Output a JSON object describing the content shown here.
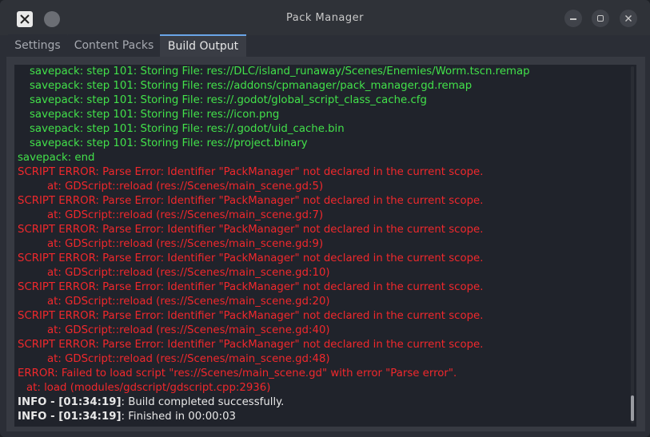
{
  "window": {
    "title": "Pack Manager"
  },
  "tabs": [
    {
      "label": "Settings",
      "active": false
    },
    {
      "label": "Content Packs",
      "active": false
    },
    {
      "label": "Build Output",
      "active": true
    }
  ],
  "console": {
    "lines": [
      {
        "text": "savepack: step 101: Storing File: res://DLC/island_runaway/Scenes/Enemies/Worm.tscn.remap",
        "color": "green",
        "indent": 1
      },
      {
        "text": "savepack: step 101: Storing File: res://addons/cpmanager/pack_manager.gd.remap",
        "color": "green",
        "indent": 1
      },
      {
        "text": "savepack: step 101: Storing File: res://.godot/global_script_class_cache.cfg",
        "color": "green",
        "indent": 1
      },
      {
        "text": "savepack: step 101: Storing File: res://icon.png",
        "color": "green",
        "indent": 1
      },
      {
        "text": "savepack: step 101: Storing File: res://.godot/uid_cache.bin",
        "color": "green",
        "indent": 1
      },
      {
        "text": "savepack: step 101: Storing File: res://project.binary",
        "color": "green",
        "indent": 1
      },
      {
        "text": "savepack: end",
        "color": "green",
        "indent": 0
      },
      {
        "text": "SCRIPT ERROR: Parse Error: Identifier \"PackManager\" not declared in the current scope.",
        "color": "red",
        "indent": 0
      },
      {
        "text": "at: GDScript::reload (res://Scenes/main_scene.gd:5)",
        "color": "red",
        "indent": 2
      },
      {
        "text": "SCRIPT ERROR: Parse Error: Identifier \"PackManager\" not declared in the current scope.",
        "color": "red",
        "indent": 0
      },
      {
        "text": "at: GDScript::reload (res://Scenes/main_scene.gd:7)",
        "color": "red",
        "indent": 2
      },
      {
        "text": "SCRIPT ERROR: Parse Error: Identifier \"PackManager\" not declared in the current scope.",
        "color": "red",
        "indent": 0
      },
      {
        "text": "at: GDScript::reload (res://Scenes/main_scene.gd:9)",
        "color": "red",
        "indent": 2
      },
      {
        "text": "SCRIPT ERROR: Parse Error: Identifier \"PackManager\" not declared in the current scope.",
        "color": "red",
        "indent": 0
      },
      {
        "text": "at: GDScript::reload (res://Scenes/main_scene.gd:10)",
        "color": "red",
        "indent": 2
      },
      {
        "text": "SCRIPT ERROR: Parse Error: Identifier \"PackManager\" not declared in the current scope.",
        "color": "red",
        "indent": 0
      },
      {
        "text": "at: GDScript::reload (res://Scenes/main_scene.gd:20)",
        "color": "red",
        "indent": 2
      },
      {
        "text": "SCRIPT ERROR: Parse Error: Identifier \"PackManager\" not declared in the current scope.",
        "color": "red",
        "indent": 0
      },
      {
        "text": "at: GDScript::reload (res://Scenes/main_scene.gd:40)",
        "color": "red",
        "indent": 2
      },
      {
        "text": "SCRIPT ERROR: Parse Error: Identifier \"PackManager\" not declared in the current scope.",
        "color": "red",
        "indent": 0
      },
      {
        "text": "at: GDScript::reload (res://Scenes/main_scene.gd:48)",
        "color": "red",
        "indent": 2
      },
      {
        "text": "ERROR: Failed to load script \"res://Scenes/main_scene.gd\" with error \"Parse error\".",
        "color": "red",
        "indent": 0
      },
      {
        "text": "at: load (modules/gdscript/gdscript.cpp:2936)",
        "color": "red",
        "indent": 3
      },
      {
        "prefix": "INFO - [01:34:19]",
        "text": ": Build completed successfully.",
        "color": "white",
        "indent": 0
      },
      {
        "prefix": "INFO - [01:34:19]",
        "text": ": Finished in 00:00:03",
        "color": "white",
        "indent": 0
      }
    ]
  },
  "colors": {
    "info_green": "#42e14a",
    "error_red": "#f0282c",
    "info_white": "#e8e8e8",
    "tab_accent": "#6aa5e8"
  },
  "icons": {
    "app": "x-logo-icon",
    "pin": "pin-icon",
    "minimize": "minimize-icon",
    "maximize": "maximize-icon",
    "close": "close-icon"
  }
}
